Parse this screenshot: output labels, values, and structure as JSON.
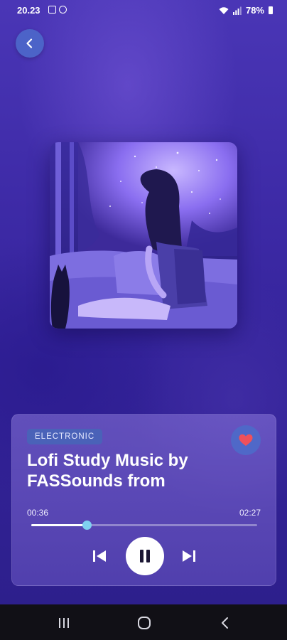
{
  "status_bar": {
    "time": "20.23",
    "battery": "78%",
    "icons": [
      "gallery-icon",
      "vpn-icon",
      "wifi-icon",
      "signal-icon",
      "battery-icon"
    ]
  },
  "header": {
    "back_icon": "chevron-left-icon"
  },
  "player": {
    "genre": "ELECTRONIC",
    "title": "Lofi Study Music by FASSounds from",
    "favorite_icon": "heart-icon",
    "current_time": "00:36",
    "total_time": "02:27",
    "progress": 0.245,
    "controls": {
      "prev_icon": "skip-previous-icon",
      "play_icon": "pause-icon",
      "next_icon": "skip-next-icon"
    }
  },
  "nav_bar": {
    "items": [
      "recent-apps-icon",
      "home-icon",
      "back-icon"
    ]
  },
  "colors": {
    "background": "#3d2aa6",
    "accent": "#4c63c8",
    "heart": "#f0505a",
    "progress_thumb": "#7fd0f0"
  }
}
